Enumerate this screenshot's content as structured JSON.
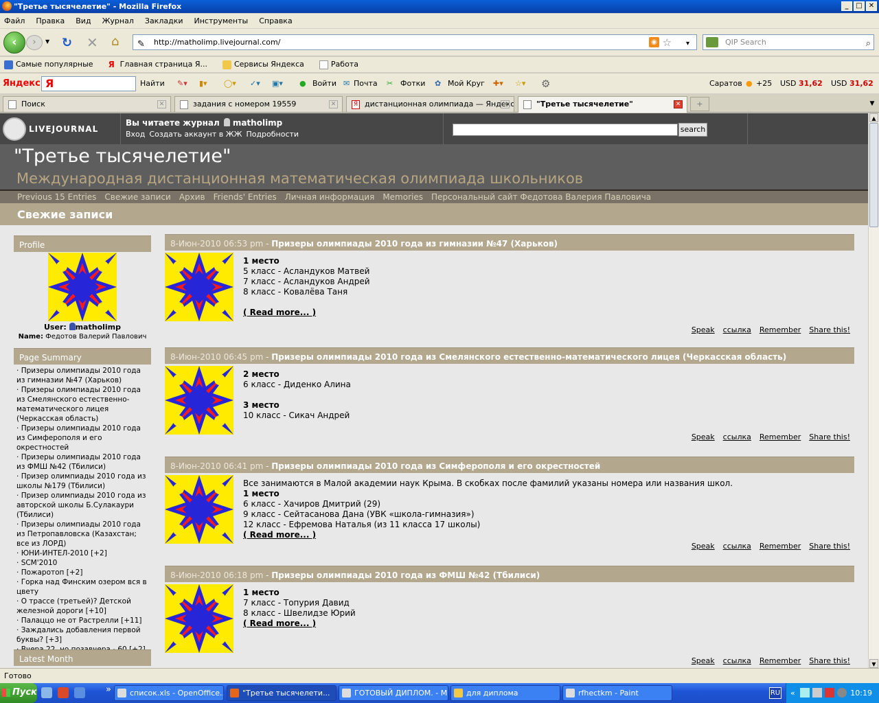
{
  "window": {
    "title": "\"Третье тысячелетие\" - Mozilla Firefox"
  },
  "menu": [
    "Файл",
    "Правка",
    "Вид",
    "Журнал",
    "Закладки",
    "Инструменты",
    "Справка"
  ],
  "nav": {
    "url": "http://matholimp.livejournal.com/",
    "search_placeholder": "QIP Search"
  },
  "bookmarks": [
    "Самые популярные",
    "Главная страница Я...",
    "Сервисы Яндекса",
    "Работа"
  ],
  "yandex_bar": {
    "logo": "Яндекс",
    "find": "Найти",
    "login": "Войти",
    "mail": "Почта",
    "photos": "Фотки",
    "circle": "Мой Круг",
    "city": "Саратов",
    "temp": "+25",
    "usd_label": "USD",
    "usd_value": "31,62"
  },
  "tabs": [
    {
      "label": "Поиск"
    },
    {
      "label": "задания с номером 19559"
    },
    {
      "label": "дистанционная олимпиада — Яндекс..."
    },
    {
      "label": "\"Третье тысячелетие\""
    }
  ],
  "lj": {
    "logo": "LIVEJOURNAL",
    "reading": "Вы читаете журнал",
    "username": "matholimp",
    "links": [
      "Вход",
      "Создать аккаунт в ЖЖ",
      "Подробности"
    ],
    "search_button": "search",
    "title": "\"Третье тысячелетие\"",
    "subtitle": "Международная дистанционная математическая олимпиада школьников",
    "nav": [
      "Previous 15 Entries",
      "Свежие записи",
      "Архив",
      "Friends' Entries",
      "Личная информация",
      "Memories",
      "Персональный сайт Федотова Валерия Павловича"
    ],
    "section": "Свежие записи"
  },
  "sidebar": {
    "profile_head": "Profile",
    "user_label": "User:",
    "user": "matholimp",
    "name_label": "Name:",
    "name": "Федотов Валерий Павлович",
    "summary_head": "Page Summary",
    "summary": [
      {
        "text": "Призеры олимпиады 2010 года из гимназии №47 (Харьков)",
        "extra": ""
      },
      {
        "text": "Призеры олимпиады 2010 года из Смелянского естественно-математического лицея (Черкасская область)",
        "extra": ""
      },
      {
        "text": "Призеры олимпиады 2010 года из Симферополя и его окрестностей",
        "extra": ""
      },
      {
        "text": "Призеры олимпиады 2010 года из ФМШ №42 (Тбилиси)",
        "extra": ""
      },
      {
        "text": "Призер олимпиады 2010 года из школы №179 (Тбилиси)",
        "extra": ""
      },
      {
        "text": "Призер олимпиады 2010 года из авторской школы Б.Сулакаури (Тбилиси)",
        "extra": ""
      },
      {
        "text": "Призеры олимпиады 2010 года из Петропавловска (Казахстан; все из ЛОРД)",
        "extra": ""
      },
      {
        "text": "ЮНИ-ИНТЕЛ-2010",
        "extra": "[+2]"
      },
      {
        "text": "SCM'2010",
        "extra": ""
      },
      {
        "text": "Пожаротоп",
        "extra": "[+2]"
      },
      {
        "text": "Горка над Финским озером вся в цвету",
        "extra": ""
      },
      {
        "text": "О трассе (третьей)? Детской железной дороги",
        "extra": "[+10]"
      },
      {
        "text": "Палаццо не от Растрелли",
        "extra": "[+11]"
      },
      {
        "text": "Заждались добавления первой буквы?",
        "extra": "[+3]"
      },
      {
        "text": "Вчера 22, но позавчера - 60",
        "extra": "[+2]"
      }
    ],
    "latest_head": "Latest Month"
  },
  "posts": [
    {
      "date": "8-Июн-2010 06:53 pm",
      "title": "Призеры олимпиады 2010 года из гимназии №47 (Харьков)",
      "lines": [
        {
          "t": "1 место",
          "b": true
        },
        {
          "t": "5 класс - Асландуков Матвей",
          "b": false
        },
        {
          "t": "7 класс - Асландуков Андрей",
          "b": false
        },
        {
          "t": "8 класс - Ковалёва Таня",
          "b": false
        },
        {
          "t": "",
          "b": false
        },
        {
          "t": "( Read more... )",
          "b": false,
          "link": true
        }
      ]
    },
    {
      "date": "8-Июн-2010 06:45 pm",
      "title": "Призеры олимпиады 2010 года из Смелянского естественно-математического лицея (Черкасская область)",
      "lines": [
        {
          "t": "2 место",
          "b": true
        },
        {
          "t": "6 класс - Диденко Алина",
          "b": false
        },
        {
          "t": "",
          "b": false
        },
        {
          "t": "3 место",
          "b": true
        },
        {
          "t": "10 класс - Сикач Андрей",
          "b": false
        }
      ]
    },
    {
      "date": "8-Июн-2010 06:41 pm",
      "title": "Призеры олимпиады 2010 года из Симферополя и его окрестностей",
      "lines": [
        {
          "t": "Все занимаются в Малой академии наук Крыма. В скобках после фамилий указаны номера или названия школ.",
          "b": false
        },
        {
          "t": "1 место",
          "b": true
        },
        {
          "t": "6 класс - Хачиров Дмитрий (29)",
          "b": false
        },
        {
          "t": "9 класс - Сейтасанова Дана (УВК «школа-гимназия»)",
          "b": false
        },
        {
          "t": "12 класс - Ефремова Наталья (из 11 класса 17 школы)",
          "b": false
        },
        {
          "t": "( Read more... )",
          "b": false,
          "link": true
        }
      ]
    },
    {
      "date": "8-Июн-2010 06:18 pm",
      "title": "Призеры олимпиады 2010 года из ФМШ №42 (Тбилиси)",
      "lines": [
        {
          "t": "1 место",
          "b": true
        },
        {
          "t": "7 класс - Топурия Давид",
          "b": false
        },
        {
          "t": "8 класс - Швелидзе Юрий",
          "b": false
        },
        {
          "t": "( Read more... )",
          "b": false,
          "link": true
        }
      ]
    }
  ],
  "post_actions": [
    "Speak",
    "ссылка",
    "Remember",
    "Share this!"
  ],
  "statusbar": "Готово",
  "taskbar": {
    "start": "Пуск",
    "tasks": [
      "список.xls - OpenOffice....",
      "\"Третье тысячелети...",
      "ГОТОВЫЙ ДИПЛОМ. - М...",
      "для диплома",
      "rfhectkm - Paint"
    ],
    "lang": "RU",
    "clock": "10:19"
  }
}
